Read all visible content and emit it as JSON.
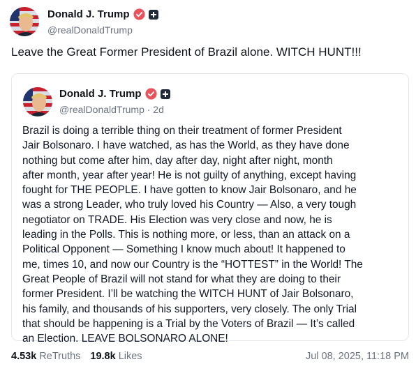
{
  "post": {
    "author_name": "Donald J. Trump",
    "handle": "@realDonaldTrump",
    "text": "Leave the Great Former President of Brazil alone. WITCH HUNT!!!"
  },
  "quoted_post": {
    "author_name": "Donald J. Trump",
    "handle": "@realDonaldTrump",
    "age": "· 2d",
    "text": "Brazil is doing a terrible thing on their treatment of former President\nJair Bolsonaro. I have watched, as has the World, as they have done\nnothing but come after him, day after day, night after night, month\nafter month, year after year! He is not guilty of anything, except having\nfought for THE PEOPLE. I have gotten to know Jair Bolsonaro, and he\nwas a strong Leader, who truly loved his Country — Also, a very tough\nnegotiator on TRADE. His Election was very close and now, he is\nleading in the Polls. This is nothing more, or less, than an attack on a\nPolitical Opponent — Something I know much about! It happened to\nme, times 10, and now our Country is the “HOTTEST” in the World! The\nGreat People of Brazil will not stand for what they are doing to their\nformer President. I’ll be watching the WITCH HUNT of Jair Bolsonaro,\nhis family, and thousands of his supporters, very closely. The only Trial\nthat should be happening is a Trial by the Voters of Brazil — It’s called\nan Election. LEAVE BOLSONARO ALONE!"
  },
  "stats": {
    "retruths_count": "4.53k",
    "retruths_label": "ReTruths",
    "likes_count": "19.8k",
    "likes_label": "Likes"
  },
  "timestamp": "Jul 08, 2025, 11:18 PM",
  "colors": {
    "verified_badge": "#e8545c",
    "muted_text": "#6b7280"
  },
  "icons": {
    "verified": "verified-badge-icon",
    "plus": "plus-badge-icon"
  }
}
